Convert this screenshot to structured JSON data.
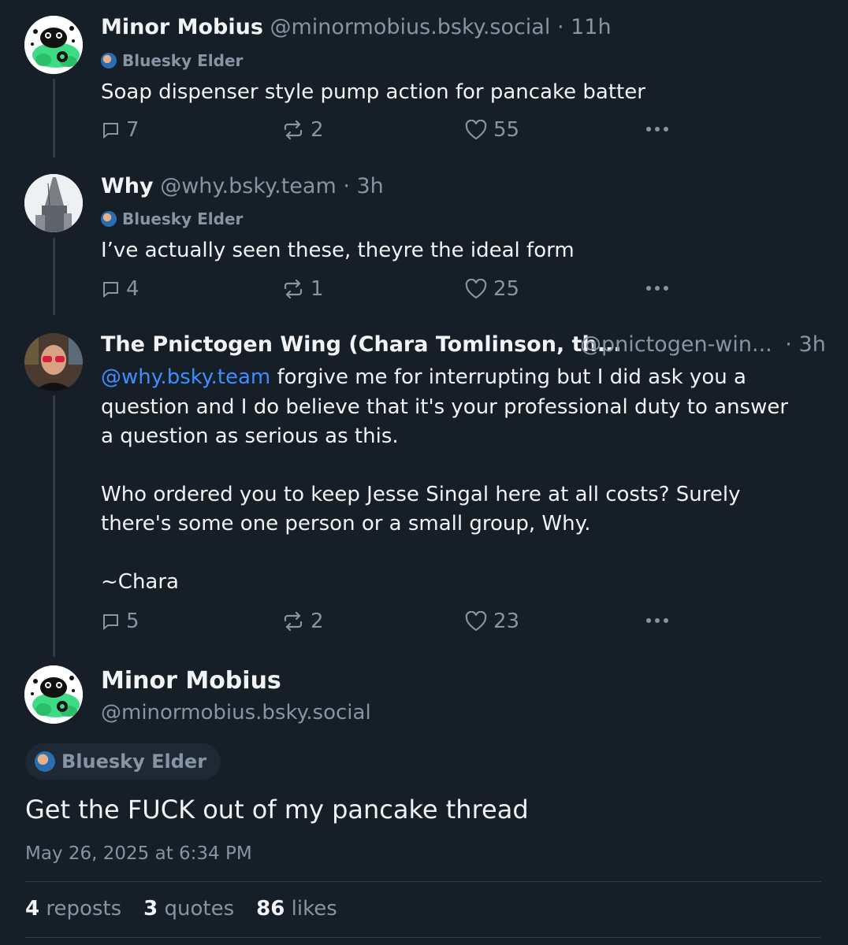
{
  "thread": [
    {
      "display_name": "Minor Mobius",
      "handle": "@minormobius.bsky.social",
      "time": "· 11h",
      "badge": "Bluesky Elder",
      "text": "Soap dispenser style pump action for pancake batter",
      "replies": "7",
      "reposts": "2",
      "likes": "55",
      "avatar_icon": "frog-avatar-icon"
    },
    {
      "display_name": "Why",
      "handle": "@why.bsky.team",
      "time": "· 3h",
      "badge": "Bluesky Elder",
      "text": "I’ve actually seen these, theyre the ideal form",
      "replies": "4",
      "reposts": "1",
      "likes": "25",
      "avatar_icon": "statue-avatar-icon"
    },
    {
      "display_name": "The Pnictogen Wing (Chara Tomlinson, th...",
      "handle": "@pnictogen-win...",
      "time": "· 3h",
      "mention": "@why.bsky.team",
      "text_line1_rest": " forgive me for interrupting but I did ask you a",
      "text_rest": "question and I do believe that it's your professional duty to answer\na question as serious as this.\n\nWho ordered you to keep Jesse Singal here at all costs? Surely\nthere's some one person or a small group, Why.\n\n~Chara",
      "replies": "5",
      "reposts": "2",
      "likes": "23",
      "avatar_icon": "person-avatar-icon"
    }
  ],
  "main_post": {
    "display_name": "Minor Mobius",
    "handle": "@minormobius.bsky.social",
    "badge": "Bluesky Elder",
    "text": "Get the FUCK out of my pancake thread",
    "timestamp": "May 26, 2025 at 6:34 PM",
    "reposts_count": "4",
    "reposts_label": "reposts",
    "quotes_count": "3",
    "quotes_label": "quotes",
    "likes_count": "86",
    "likes_label": "likes"
  },
  "colors": {
    "background": "#161e27",
    "text": "#f1f3f5",
    "muted": "#8794a3",
    "link": "#3d8eff",
    "line": "#2e3a47",
    "frog_green": "#3ddc84"
  }
}
